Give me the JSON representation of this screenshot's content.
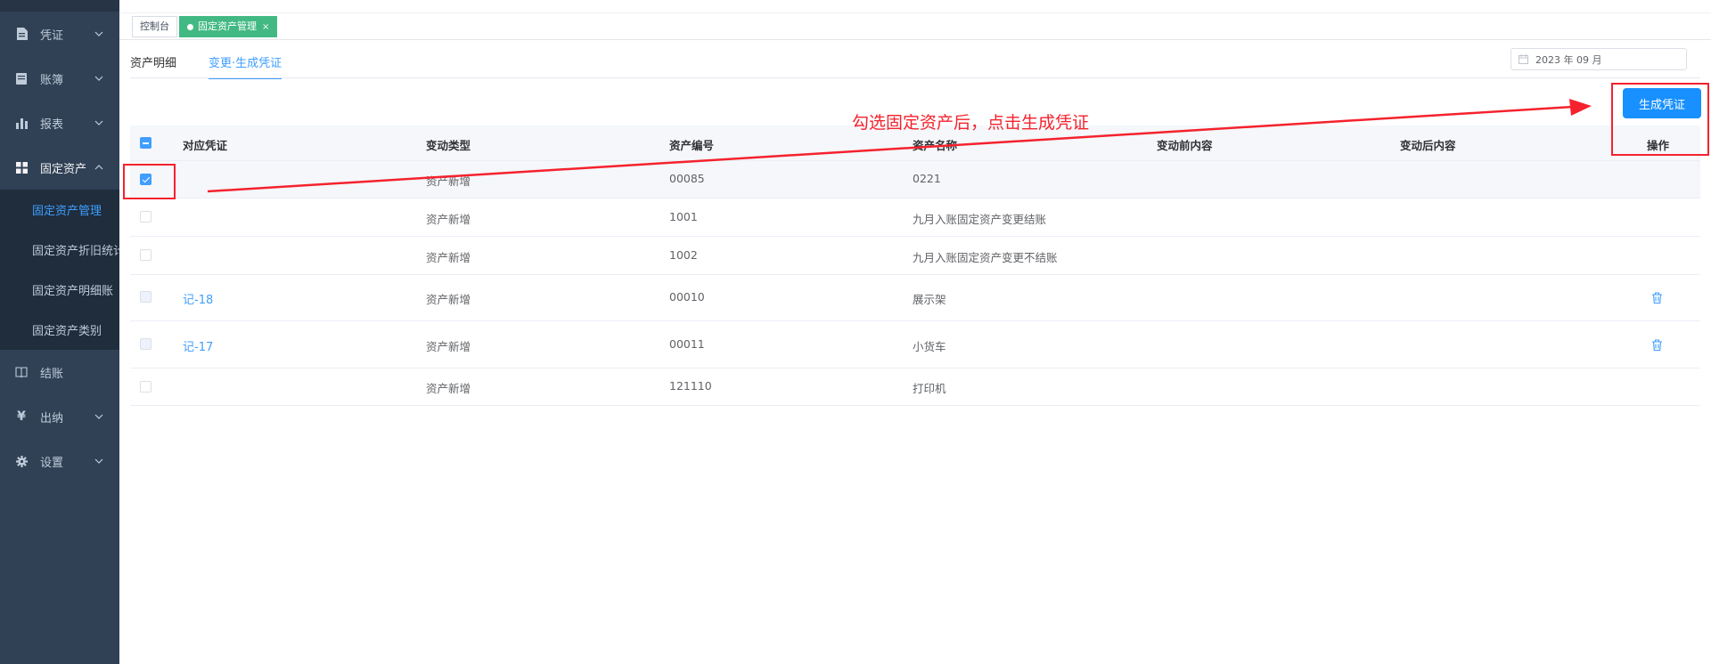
{
  "sidebar": {
    "items": [
      {
        "label": "凭证"
      },
      {
        "label": "账簿"
      },
      {
        "label": "报表"
      },
      {
        "label": "固定资产"
      },
      {
        "label": "结账"
      },
      {
        "label": "出纳"
      },
      {
        "label": "设置"
      }
    ],
    "submenu": [
      {
        "label": "固定资产管理"
      },
      {
        "label": "固定资产折旧统计"
      },
      {
        "label": "固定资产明细账"
      },
      {
        "label": "固定资产类别"
      }
    ]
  },
  "tags": {
    "console": "控制台",
    "active": "固定资产管理",
    "close": "×"
  },
  "tabs": [
    {
      "label": "资产明细"
    },
    {
      "label": "变更·生成凭证"
    }
  ],
  "date_picker": {
    "value": "2023 年 09 月"
  },
  "generate_button": "生成凭证",
  "table": {
    "headers": [
      "对应凭证",
      "变动类型",
      "资产编号",
      "资产名称",
      "变动前内容",
      "变动后内容",
      "操作"
    ],
    "rows": [
      {
        "voucher": "",
        "type": "资产新增",
        "code": "00085",
        "name": "0221",
        "before": "",
        "after": ""
      },
      {
        "voucher": "",
        "type": "资产新增",
        "code": "1001",
        "name": "九月入账固定资产变更结账",
        "before": "",
        "after": ""
      },
      {
        "voucher": "",
        "type": "资产新增",
        "code": "1002",
        "name": "九月入账固定资产变更不结账",
        "before": "",
        "after": ""
      },
      {
        "voucher": "记-18",
        "type": "资产新增",
        "code": "00010",
        "name": "展示架",
        "before": "",
        "after": ""
      },
      {
        "voucher": "记-17",
        "type": "资产新增",
        "code": "00011",
        "name": "小货车",
        "before": "",
        "after": ""
      },
      {
        "voucher": "",
        "type": "资产新增",
        "code": "121110",
        "name": "打印机",
        "before": "",
        "after": ""
      }
    ]
  },
  "annotation": {
    "text": "勾选固定资产后，点击生成凭证"
  },
  "colors": {
    "sidebar_bg": "#304156",
    "accent": "#409eff",
    "primary_button": "#1890ff",
    "tag_active": "#42b983",
    "annotation_red": "#f5222d"
  }
}
